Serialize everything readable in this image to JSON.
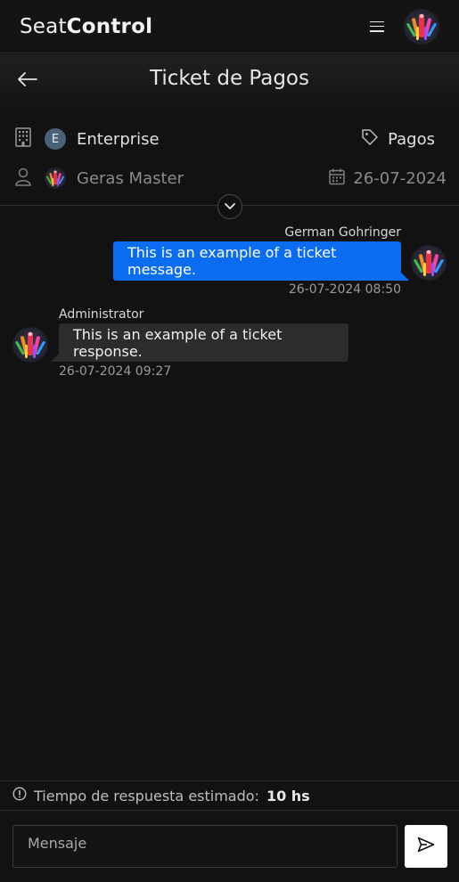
{
  "app": {
    "brand_light": "Seat",
    "brand_bold": "Control"
  },
  "header": {
    "title": "Ticket de Pagos"
  },
  "ticket": {
    "company": "Enterprise",
    "company_initial": "E",
    "category": "Pagos",
    "user": "Geras Master",
    "date": "26-07-2024"
  },
  "messages": [
    {
      "author": "German Gohringer",
      "text": "This is an example of a ticket message.",
      "time": "26-07-2024 08:50",
      "direction": "outgoing"
    },
    {
      "author": "Administrator",
      "text": "This is an example of a ticket response.",
      "time": "26-07-2024 09:27",
      "direction": "incoming"
    }
  ],
  "footer": {
    "eta_label": "Tiempo de respuesta estimado:",
    "eta_value": "10 hs",
    "input_placeholder": "Mensaje"
  },
  "icons": {
    "menu": "hamburger-icon",
    "back": "arrow-left-icon",
    "company": "building-icon",
    "category": "tag-icon",
    "user": "user-icon",
    "date": "calendar-icon",
    "collapse": "chevron-down-icon",
    "info": "info-circle-icon",
    "send": "send-icon"
  },
  "colors": {
    "accent": "#0a6cf1",
    "background": "#121212",
    "incoming_bubble": "#2c2c2c"
  }
}
